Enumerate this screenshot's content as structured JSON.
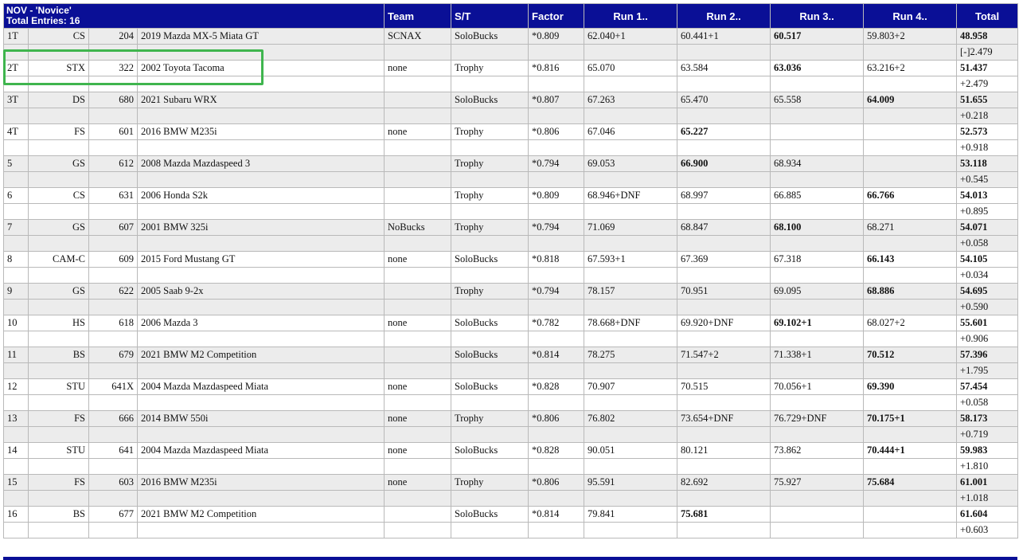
{
  "header": {
    "class_title": "NOV - 'Novice'",
    "total_entries": "Total Entries: 16",
    "columns": [
      "Team",
      "S/T",
      "Factor",
      "Run 1..",
      "Run 2..",
      "Run 3..",
      "Run 4..",
      "Total"
    ]
  },
  "entries": [
    {
      "pos": "1T",
      "cls": "CS",
      "num": "204",
      "car": "2019 Mazda MX-5 Miata GT",
      "team": "SCNAX",
      "st": "SoloBucks",
      "factor": "*0.809",
      "runs": [
        "62.040+1",
        "60.441+1",
        "60.517",
        "59.803+2"
      ],
      "best": 2,
      "total": "48.958",
      "diff": "[-]2.479"
    },
    {
      "pos": "2T",
      "cls": "STX",
      "num": "322",
      "car": "2002 Toyota Tacoma",
      "team": "none",
      "st": "Trophy",
      "factor": "*0.816",
      "runs": [
        "65.070",
        "63.584",
        "63.036",
        "63.216+2"
      ],
      "best": 2,
      "total": "51.437",
      "diff": "+2.479"
    },
    {
      "pos": "3T",
      "cls": "DS",
      "num": "680",
      "car": "2021 Subaru WRX",
      "team": "",
      "st": "SoloBucks",
      "factor": "*0.807",
      "runs": [
        "67.263",
        "65.470",
        "65.558",
        "64.009"
      ],
      "best": 3,
      "total": "51.655",
      "diff": "+0.218"
    },
    {
      "pos": "4T",
      "cls": "FS",
      "num": "601",
      "car": "2016 BMW M235i",
      "team": "none",
      "st": "Trophy",
      "factor": "*0.806",
      "runs": [
        "67.046",
        "65.227",
        "",
        ""
      ],
      "best": 1,
      "total": "52.573",
      "diff": "+0.918"
    },
    {
      "pos": "5",
      "cls": "GS",
      "num": "612",
      "car": "2008 Mazda Mazdaspeed 3",
      "team": "",
      "st": "Trophy",
      "factor": "*0.794",
      "runs": [
        "69.053",
        "66.900",
        "68.934",
        ""
      ],
      "best": 1,
      "total": "53.118",
      "diff": "+0.545"
    },
    {
      "pos": "6",
      "cls": "CS",
      "num": "631",
      "car": "2006 Honda S2k",
      "team": "",
      "st": "Trophy",
      "factor": "*0.809",
      "runs": [
        "68.946+DNF",
        "68.997",
        "66.885",
        "66.766"
      ],
      "best": 3,
      "total": "54.013",
      "diff": "+0.895"
    },
    {
      "pos": "7",
      "cls": "GS",
      "num": "607",
      "car": "2001 BMW 325i",
      "team": "NoBucks",
      "st": "Trophy",
      "factor": "*0.794",
      "runs": [
        "71.069",
        "68.847",
        "68.100",
        "68.271"
      ],
      "best": 2,
      "total": "54.071",
      "diff": "+0.058"
    },
    {
      "pos": "8",
      "cls": "CAM-C",
      "num": "609",
      "car": "2015 Ford Mustang GT",
      "team": "none",
      "st": "SoloBucks",
      "factor": "*0.818",
      "runs": [
        "67.593+1",
        "67.369",
        "67.318",
        "66.143"
      ],
      "best": 3,
      "total": "54.105",
      "diff": "+0.034"
    },
    {
      "pos": "9",
      "cls": "GS",
      "num": "622",
      "car": "2005 Saab 9-2x",
      "team": "",
      "st": "Trophy",
      "factor": "*0.794",
      "runs": [
        "78.157",
        "70.951",
        "69.095",
        "68.886"
      ],
      "best": 3,
      "total": "54.695",
      "diff": "+0.590"
    },
    {
      "pos": "10",
      "cls": "HS",
      "num": "618",
      "car": "2006 Mazda 3",
      "team": "none",
      "st": "SoloBucks",
      "factor": "*0.782",
      "runs": [
        "78.668+DNF",
        "69.920+DNF",
        "69.102+1",
        "68.027+2"
      ],
      "best": 2,
      "total": "55.601",
      "diff": "+0.906"
    },
    {
      "pos": "11",
      "cls": "BS",
      "num": "679",
      "car": "2021 BMW M2 Competition",
      "team": "",
      "st": "SoloBucks",
      "factor": "*0.814",
      "runs": [
        "78.275",
        "71.547+2",
        "71.338+1",
        "70.512"
      ],
      "best": 3,
      "total": "57.396",
      "diff": "+1.795"
    },
    {
      "pos": "12",
      "cls": "STU",
      "num": "641X",
      "car": "2004 Mazda Mazdaspeed Miata",
      "team": "none",
      "st": "SoloBucks",
      "factor": "*0.828",
      "runs": [
        "70.907",
        "70.515",
        "70.056+1",
        "69.390"
      ],
      "best": 3,
      "total": "57.454",
      "diff": "+0.058"
    },
    {
      "pos": "13",
      "cls": "FS",
      "num": "666",
      "car": "2014 BMW 550i",
      "team": "none",
      "st": "Trophy",
      "factor": "*0.806",
      "runs": [
        "76.802",
        "73.654+DNF",
        "76.729+DNF",
        "70.175+1"
      ],
      "best": 3,
      "total": "58.173",
      "diff": "+0.719"
    },
    {
      "pos": "14",
      "cls": "STU",
      "num": "641",
      "car": "2004 Mazda Mazdaspeed Miata",
      "team": "none",
      "st": "SoloBucks",
      "factor": "*0.828",
      "runs": [
        "90.051",
        "80.121",
        "73.862",
        "70.444+1"
      ],
      "best": 3,
      "total": "59.983",
      "diff": "+1.810"
    },
    {
      "pos": "15",
      "cls": "FS",
      "num": "603",
      "car": "2016 BMW M235i",
      "team": "none",
      "st": "Trophy",
      "factor": "*0.806",
      "runs": [
        "95.591",
        "82.692",
        "75.927",
        "75.684"
      ],
      "best": 3,
      "total": "61.001",
      "diff": "+1.018"
    },
    {
      "pos": "16",
      "cls": "BS",
      "num": "677",
      "car": "2021 BMW M2 Competition",
      "team": "",
      "st": "SoloBucks",
      "factor": "*0.814",
      "runs": [
        "79.841",
        "75.681",
        "",
        ""
      ],
      "best": 1,
      "total": "61.604",
      "diff": "+0.603"
    }
  ],
  "annotation": {
    "highlight_color": "#3fb54e",
    "highlighted_entry": "2T"
  }
}
